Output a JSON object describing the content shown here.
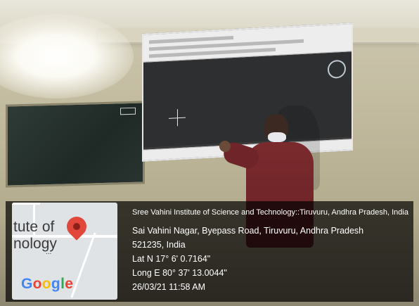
{
  "map_tile": {
    "text_top": "tute of",
    "text_bottom": "nology",
    "ellipsis": "...",
    "brand_letters": [
      "G",
      "o",
      "o",
      "g",
      "l",
      "e"
    ]
  },
  "geo_stamp": {
    "institute": "Sree Vahini Institute of Science and Technology::Tiruvuru, Andhra Pradesh, India",
    "address_line1": "Sai Vahini Nagar, Byepass Road, Tiruvuru, Andhra Pradesh",
    "address_line2": "521235, India",
    "latitude": "Lat N 17° 6' 0.7164\"",
    "longitude": "Long E 80° 37' 13.0044\"",
    "datetime": "26/03/21 11:58 AM"
  }
}
